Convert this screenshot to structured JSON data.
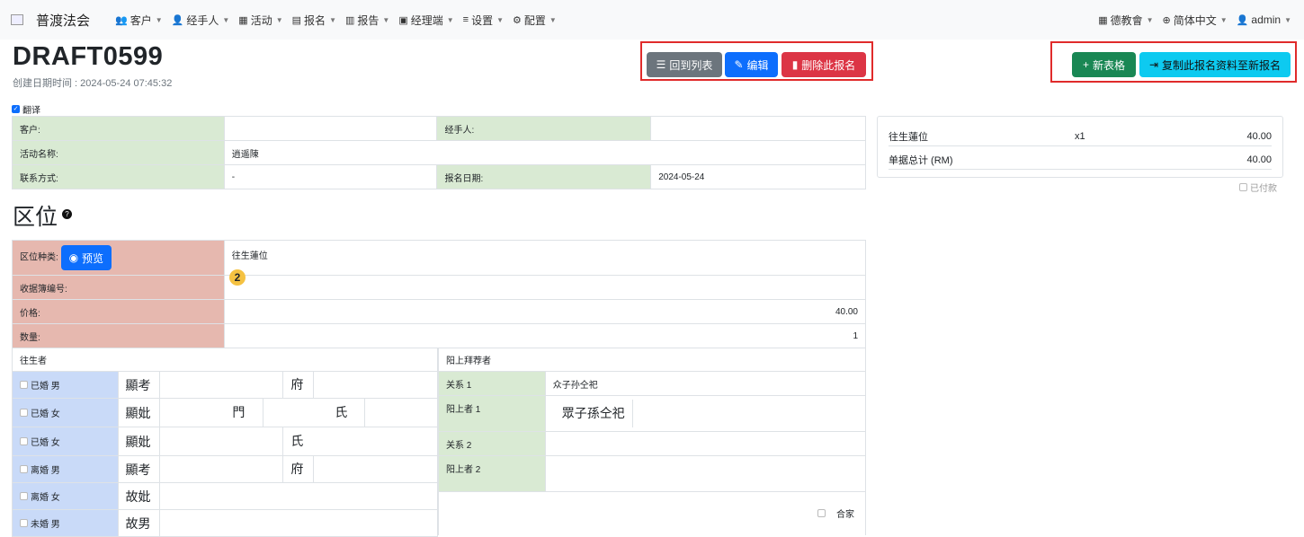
{
  "nav": {
    "brand": "普渡法会",
    "items": [
      {
        "icon": "users-icon",
        "glyph": "👥",
        "label": "客户"
      },
      {
        "icon": "user-icon",
        "glyph": "👤",
        "label": "经手人"
      },
      {
        "icon": "columns-icon",
        "glyph": "▦",
        "label": "活动"
      },
      {
        "icon": "list-icon",
        "glyph": "▤",
        "label": "报名"
      },
      {
        "icon": "report-icon",
        "glyph": "▥",
        "label": "报告"
      },
      {
        "icon": "briefcase-icon",
        "glyph": "▣",
        "label": "经理端"
      },
      {
        "icon": "sliders-icon",
        "glyph": "≡",
        "label": "设置"
      },
      {
        "icon": "gear-icon",
        "glyph": "⚙",
        "label": "配置"
      }
    ],
    "right": [
      {
        "icon": "org-icon",
        "glyph": "▦",
        "label": "德教會"
      },
      {
        "icon": "globe-icon",
        "glyph": "⊕",
        "label": "简体中文"
      },
      {
        "icon": "user-icon",
        "glyph": "👤",
        "label": "admin"
      }
    ]
  },
  "page": {
    "title": "DRAFT0599",
    "created": "创建日期时间 : 2024-05-24 07:45:32"
  },
  "actions": {
    "back": "回到列表",
    "edit": "编辑",
    "delete": "删除此报名",
    "new_form": "新表格",
    "copy": "复制此报名资料至新报名"
  },
  "translate_label": "翻译",
  "info": {
    "customer_label": "客户:",
    "customer_value": "",
    "handler_label": "经手人:",
    "handler_value": "",
    "event_label": "活动名称:",
    "event_value": "逍遥陳",
    "contact_label": "联系方式:",
    "contact_value": "-",
    "date_label": "报名日期:",
    "date_value": "2024-05-24"
  },
  "summary": {
    "item_name": "往生蓮位",
    "item_qty": "x1",
    "item_amount": "40.00",
    "total_label": "单据总计 (RM)",
    "total_amount": "40.00",
    "paid_label": "已付款"
  },
  "section": {
    "title": "区位",
    "help": "?"
  },
  "slot": {
    "type_label": "区位种类:",
    "preview": "预览",
    "type_value": "往生蓮位",
    "badge": "2",
    "receipt_label": "收据簿编号:",
    "price_label": "价格:",
    "price_value": "40.00",
    "qty_label": "数量:",
    "qty_value": "1"
  },
  "deceased": {
    "header": "往生者",
    "rows": [
      {
        "status": "已婚 男",
        "title": "顯考",
        "suffix": "府"
      },
      {
        "status": "已婚 女",
        "title": "顯妣",
        "mid": "門",
        "suffix": "氏"
      },
      {
        "status": "已婚 女",
        "title": "顯妣",
        "suffix": "氏"
      },
      {
        "status": "离婚 男",
        "title": "顯考",
        "suffix": "府"
      },
      {
        "status": "离婚 女",
        "title": "故妣"
      },
      {
        "status": "未婚 男",
        "title": "故男"
      }
    ]
  },
  "living": {
    "header": "阳上拜荐者",
    "rel1_label": "关系 1",
    "rel1_value": "众子孙仝祀",
    "person1_label": "阳上者 1",
    "person1_value": "眾子孫仝祀",
    "rel2_label": "关系 2",
    "person2_label": "阳上者 2",
    "family_label": "合家"
  }
}
